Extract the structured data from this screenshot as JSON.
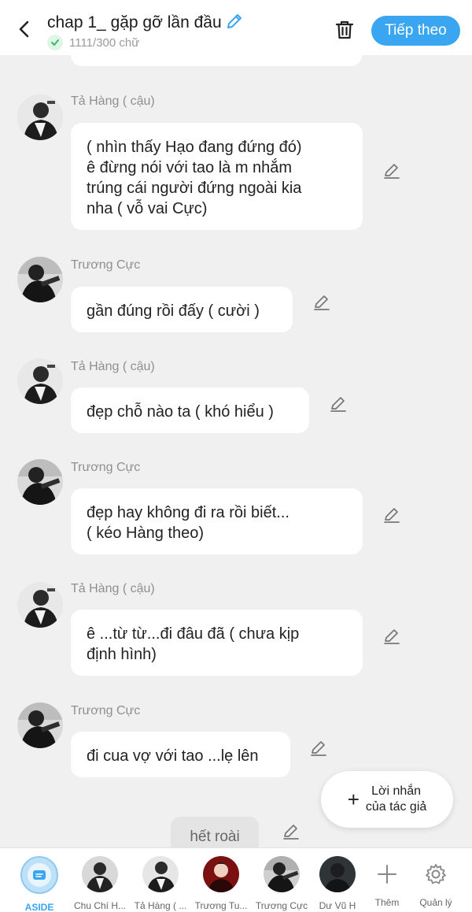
{
  "header": {
    "title": "chap 1_ gặp gỡ lần đầu",
    "word_count": "1111/300 chữ",
    "next_label": "Tiếp theo"
  },
  "messages": [
    {
      "name": "Tả Hàng ( cậu)",
      "text": "( nhìn thấy Hạo đang đứng đó)\nê đừng nói với tao là m nhắm\ntrúng cái người đứng ngoài kia\nnha ( vỗ vai Cực)"
    },
    {
      "name": "Trương Cực",
      "text": "gần đúng rồi đấy ( cười )"
    },
    {
      "name": "Tả Hàng ( cậu)",
      "text": "đẹp chỗ nào ta ( khó hiểu )"
    },
    {
      "name": "Trương Cực",
      "text": "đẹp hay không đi ra rồi biết...\n( kéo Hàng theo)"
    },
    {
      "name": "Tả Hàng ( cậu)",
      "text": "ê ...từ từ...đi đâu đã ( chưa kịp\nđịnh hình)"
    },
    {
      "name": "Trương Cực",
      "text": "đi cua vợ với tao ...lẹ lên"
    }
  ],
  "end_note": "hết roài",
  "author_note": {
    "line1": "Lời nhắn",
    "line2": "của tác giả"
  },
  "bottom_bar": {
    "aside": "ASIDE",
    "characters": [
      "Chu Chí H...",
      "Tả Hàng ( ...",
      "Trương Tu...",
      "Trương Cực",
      "Dư Vũ H"
    ],
    "more": "Thêm",
    "manage": "Quản lý"
  },
  "colors": {
    "accent": "#3aa6f2",
    "background": "#f0f0f0",
    "bubble": "#ffffff",
    "check": "#3cb867"
  }
}
